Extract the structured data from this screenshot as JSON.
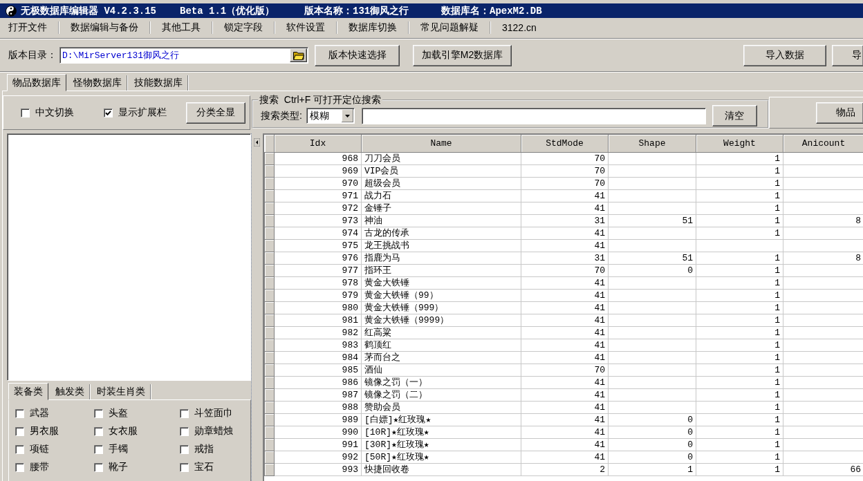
{
  "window": {
    "title": "无极数据库编辑器 V4.2.3.15",
    "edition": "Beta 1.1（优化版）",
    "version_name": "版本名称：131御风之行",
    "database_name": "数据库名：ApexM2.DB"
  },
  "menu": [
    "打开文件",
    "数据编辑与备份",
    "其他工具",
    "锁定字段",
    "软件设置",
    "数据库切换",
    "常见问题解疑",
    "3122.cn"
  ],
  "toolbar": {
    "directory_label": "版本目录：",
    "directory_value": "D:\\MirServer131御风之行",
    "buttons": [
      "版本快速选择",
      "加载引擎M2数据库"
    ],
    "right_buttons": [
      "导入数据",
      "导"
    ]
  },
  "tabs": [
    {
      "label": "物品数据库",
      "selected": true
    },
    {
      "label": "怪物数据库",
      "selected": false
    },
    {
      "label": "技能数据库",
      "selected": false
    }
  ],
  "options": {
    "checkboxes": [
      {
        "label": "中文切换",
        "checked": false
      },
      {
        "label": "显示扩展栏",
        "checked": true
      }
    ],
    "button": "分类全显"
  },
  "search": {
    "title": "搜索  Ctrl+F 可打开定位搜索",
    "type_label": "搜索类型:",
    "type_value": "模糊",
    "button": "清空"
  },
  "side_button": "物品",
  "category_tabs": [
    {
      "label": "装备类",
      "selected": true
    },
    {
      "label": "触发类",
      "selected": false
    },
    {
      "label": "时装生肖类",
      "selected": false
    }
  ],
  "categories": [
    {
      "label": "武器",
      "checked": false
    },
    {
      "label": "头盔",
      "checked": false
    },
    {
      "label": "斗笠面巾",
      "checked": false
    },
    {
      "label": "男衣服",
      "checked": false
    },
    {
      "label": "女衣服",
      "checked": false
    },
    {
      "label": "勋章蜡烛",
      "checked": false
    },
    {
      "label": "项链",
      "checked": false
    },
    {
      "label": "手镯",
      "checked": false
    },
    {
      "label": "戒指",
      "checked": false
    },
    {
      "label": "腰带",
      "checked": false
    },
    {
      "label": "靴子",
      "checked": false
    },
    {
      "label": "宝石",
      "checked": false
    }
  ],
  "table": {
    "columns": [
      "Idx",
      "Name",
      "StdMode",
      "Shape",
      "Weight",
      "Anicount"
    ],
    "rows": [
      {
        "idx": "968",
        "name": "刀刀会员",
        "stdmode": "70",
        "weight": "1"
      },
      {
        "idx": "969",
        "name": "VIP会员",
        "stdmode": "70",
        "weight": "1"
      },
      {
        "idx": "970",
        "name": "超级会员",
        "stdmode": "70",
        "weight": "1"
      },
      {
        "idx": "971",
        "name": "战力石",
        "stdmode": "41",
        "weight": "1"
      },
      {
        "idx": "972",
        "name": "金锤子",
        "stdmode": "41",
        "weight": "1"
      },
      {
        "idx": "973",
        "name": "神油",
        "stdmode": "31",
        "shape": "51",
        "weight": "1",
        "anicount": "8"
      },
      {
        "idx": "974",
        "name": "古龙的传承",
        "stdmode": "41",
        "weight": "1"
      },
      {
        "idx": "975",
        "name": "龙王挑战书",
        "stdmode": "41"
      },
      {
        "idx": "976",
        "name": "指鹿为马",
        "stdmode": "31",
        "shape": "51",
        "weight": "1",
        "anicount": "8"
      },
      {
        "idx": "977",
        "name": "指环王",
        "stdmode": "70",
        "shape": "0",
        "weight": "1"
      },
      {
        "idx": "978",
        "name": "黄金大铁锤",
        "stdmode": "41",
        "weight": "1"
      },
      {
        "idx": "979",
        "name": "黄金大铁锤（99）",
        "stdmode": "41",
        "weight": "1"
      },
      {
        "idx": "980",
        "name": "黄金大铁锤（999）",
        "stdmode": "41",
        "weight": "1"
      },
      {
        "idx": "981",
        "name": "黄金大铁锤（9999）",
        "stdmode": "41",
        "weight": "1"
      },
      {
        "idx": "982",
        "name": "红高粱",
        "stdmode": "41",
        "weight": "1"
      },
      {
        "idx": "983",
        "name": "鹤顶红",
        "stdmode": "41",
        "weight": "1"
      },
      {
        "idx": "984",
        "name": "茅而台之",
        "stdmode": "41",
        "weight": "1"
      },
      {
        "idx": "985",
        "name": "酒仙",
        "stdmode": "70",
        "weight": "1"
      },
      {
        "idx": "986",
        "name": "镜像之罚（一）",
        "stdmode": "41",
        "weight": "1"
      },
      {
        "idx": "987",
        "name": "镜像之罚（二）",
        "stdmode": "41",
        "weight": "1"
      },
      {
        "idx": "988",
        "name": "赞助会员",
        "stdmode": "41",
        "weight": "1"
      },
      {
        "idx": "989",
        "name": "[白嫖]★红玫瑰★",
        "stdmode": "41",
        "shape": "0",
        "weight": "1"
      },
      {
        "idx": "990",
        "name": "[10R]★红玫瑰★",
        "stdmode": "41",
        "shape": "0",
        "weight": "1"
      },
      {
        "idx": "991",
        "name": "[30R]★红玫瑰★",
        "stdmode": "41",
        "shape": "0",
        "weight": "1"
      },
      {
        "idx": "992",
        "name": "[50R]★红玫瑰★",
        "stdmode": "41",
        "shape": "0",
        "weight": "1"
      },
      {
        "idx": "993",
        "name": "快捷回收卷",
        "stdmode": "2",
        "shape": "1",
        "weight": "1",
        "anicount": "66"
      }
    ]
  }
}
